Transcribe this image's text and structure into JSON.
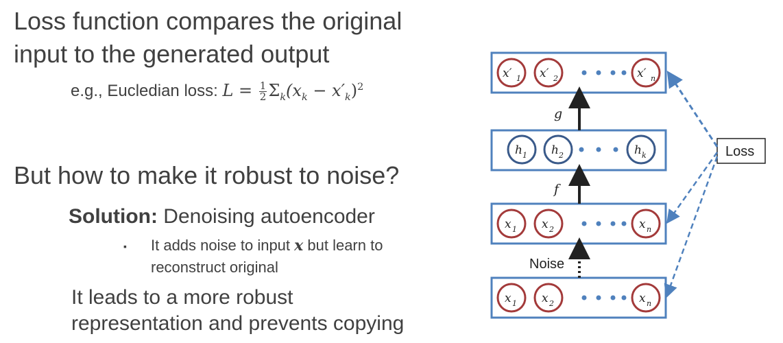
{
  "title": {
    "line1": "Loss function compares the original",
    "line2": "input to the generated output"
  },
  "example": {
    "prefix": "e.g., Eucledian loss:",
    "lhs": "L",
    "eq": "=",
    "frac_num": "1",
    "frac_den": "2",
    "sum": "Σ",
    "sum_sub": "k",
    "expr_open": "(x",
    "expr_k1": "k",
    "expr_mid": " − x′",
    "expr_k2": "k",
    "expr_close": ")",
    "power": "2"
  },
  "question": "But how to make it robust to noise?",
  "solution": {
    "bold": "Solution:",
    "text": " Denoising autoencoder"
  },
  "bullet": {
    "marker": "▪",
    "part1": "It adds noise to input ",
    "var": "x",
    "part2": " but learn to",
    "line2": "reconstruct original"
  },
  "conclusion": {
    "line1": "It leads to a more robust",
    "line2": "representation and prevents copying"
  },
  "diagram": {
    "layers": [
      {
        "name": "output",
        "nodes": [
          {
            "base": "x′",
            "sub": "1"
          },
          {
            "base": "x′",
            "sub": "2"
          },
          {
            "base": "x′",
            "sub": "n"
          }
        ],
        "node_color": "#a33a3a"
      },
      {
        "name": "hidden",
        "nodes": [
          {
            "base": "h",
            "sub": "1"
          },
          {
            "base": "h",
            "sub": "2"
          },
          {
            "base": "h",
            "sub": "k"
          }
        ],
        "node_color": "#3a5a8a"
      },
      {
        "name": "noisy-input",
        "nodes": [
          {
            "base": "x",
            "sub": "1"
          },
          {
            "base": "x",
            "sub": "2"
          },
          {
            "base": "x",
            "sub": "n"
          }
        ],
        "node_color": "#a33a3a"
      },
      {
        "name": "input",
        "nodes": [
          {
            "base": "x",
            "sub": "1"
          },
          {
            "base": "x",
            "sub": "2"
          },
          {
            "base": "x",
            "sub": "n"
          }
        ],
        "node_color": "#a33a3a"
      }
    ],
    "decoder_label": "g",
    "encoder_label": "f",
    "noise_label": "Noise",
    "loss_label": "Loss",
    "colors": {
      "box_border": "#4f81bd",
      "dot": "#4f81bd",
      "dashed_arrow": "#4f81bd",
      "solid_arrow": "#222222"
    }
  }
}
